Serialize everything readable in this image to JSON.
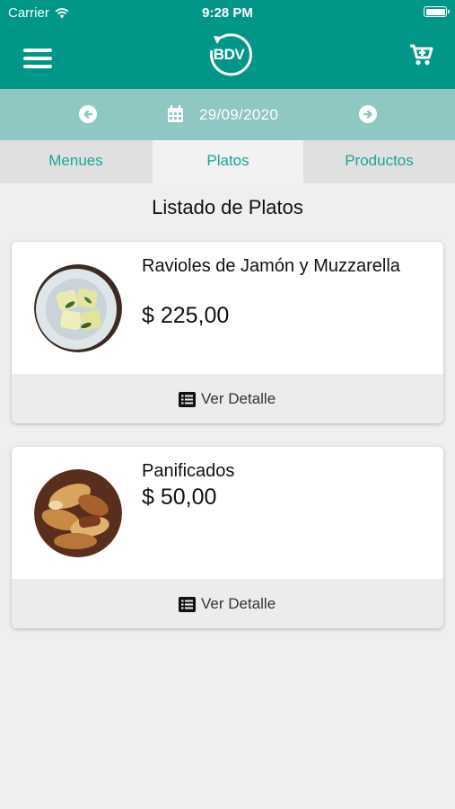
{
  "status_bar": {
    "carrier": "Carrier",
    "time": "9:28 PM"
  },
  "header": {
    "logo_text": "BDV",
    "menu_icon": "hamburger-icon",
    "cart_icon": "cart-icon"
  },
  "date_nav": {
    "date": "29/09/2020",
    "prev_icon": "arrow-left-circle-icon",
    "next_icon": "arrow-right-circle-icon",
    "calendar_icon": "calendar-icon"
  },
  "tabs": [
    {
      "label": "Menues",
      "active": false
    },
    {
      "label": "Platos",
      "active": true
    },
    {
      "label": "Productos",
      "active": false
    }
  ],
  "list_title": "Listado de Platos",
  "items": [
    {
      "name": "Ravioles de Jamón y Muzzarella",
      "price": "$ 225,00",
      "detail_label": "Ver Detalle",
      "image": "ravioli-plate"
    },
    {
      "name": "Panificados",
      "price": "$ 50,00",
      "detail_label": "Ver Detalle",
      "image": "bread-pastries"
    }
  ],
  "colors": {
    "primary": "#009688",
    "date_bar": "#8fc7c2",
    "tab_text": "#1aa39a",
    "background": "#efefef"
  }
}
